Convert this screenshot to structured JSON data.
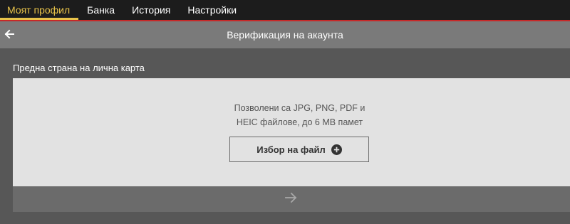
{
  "nav": {
    "tabs": [
      {
        "label": "Моят профил",
        "active": true
      },
      {
        "label": "Банка",
        "active": false
      },
      {
        "label": "История",
        "active": false
      },
      {
        "label": "Настройки",
        "active": false
      }
    ],
    "accent_color": "#e8c34a",
    "divider_color": "#c62828"
  },
  "header": {
    "title": "Верификация на акаунта",
    "back_icon": "arrow-left-icon"
  },
  "section": {
    "label": "Предна страна на лична карта"
  },
  "upload": {
    "info_line1": "Позволени са JPG, PNG, PDF и",
    "info_line2": "HEIC файлове, до 6 MB памет",
    "button_label": "Избор на файл",
    "button_icon": "plus-circle-icon"
  },
  "submit": {
    "icon": "arrow-right-icon"
  }
}
